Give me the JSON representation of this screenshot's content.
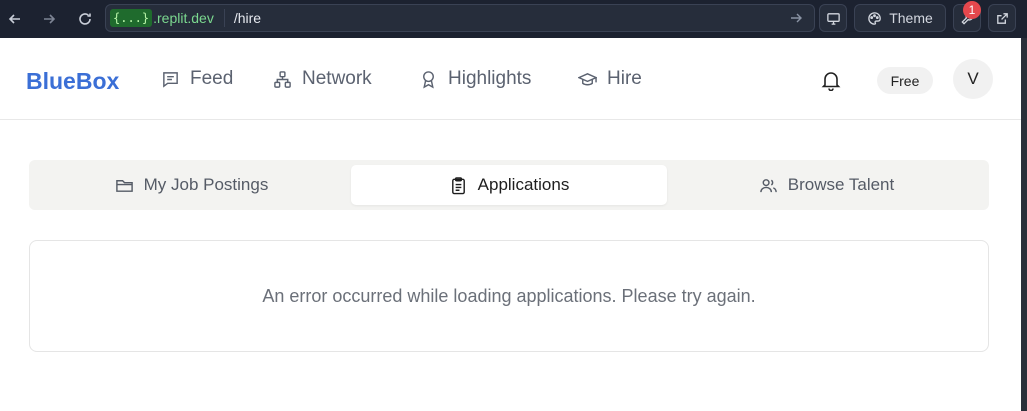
{
  "browser": {
    "url_badge": "{...}",
    "url_host": ".replit.dev",
    "url_path": "/hire",
    "theme_label": "Theme",
    "notification_count": "1"
  },
  "header": {
    "brand": "BlueBox",
    "nav": [
      {
        "label": "Feed",
        "icon": "message-square-icon"
      },
      {
        "label": "Network",
        "icon": "network-icon"
      },
      {
        "label": "Highlights",
        "icon": "award-icon"
      },
      {
        "label": "Hire",
        "icon": "graduation-cap-icon"
      }
    ],
    "plan": "Free",
    "avatar_initial": "V"
  },
  "tabs": [
    {
      "label": "My Job Postings",
      "icon": "folder-icon",
      "active": false
    },
    {
      "label": "Applications",
      "icon": "clipboard-icon",
      "active": true
    },
    {
      "label": "Browse Talent",
      "icon": "users-icon",
      "active": false
    }
  ],
  "error": {
    "message": "An error occurred while loading applications. Please try again."
  },
  "colors": {
    "brand": "#3b6fd6",
    "chrome_bg": "#1c2230",
    "url_host": "#7bd88f",
    "badge": "#e5484d"
  }
}
